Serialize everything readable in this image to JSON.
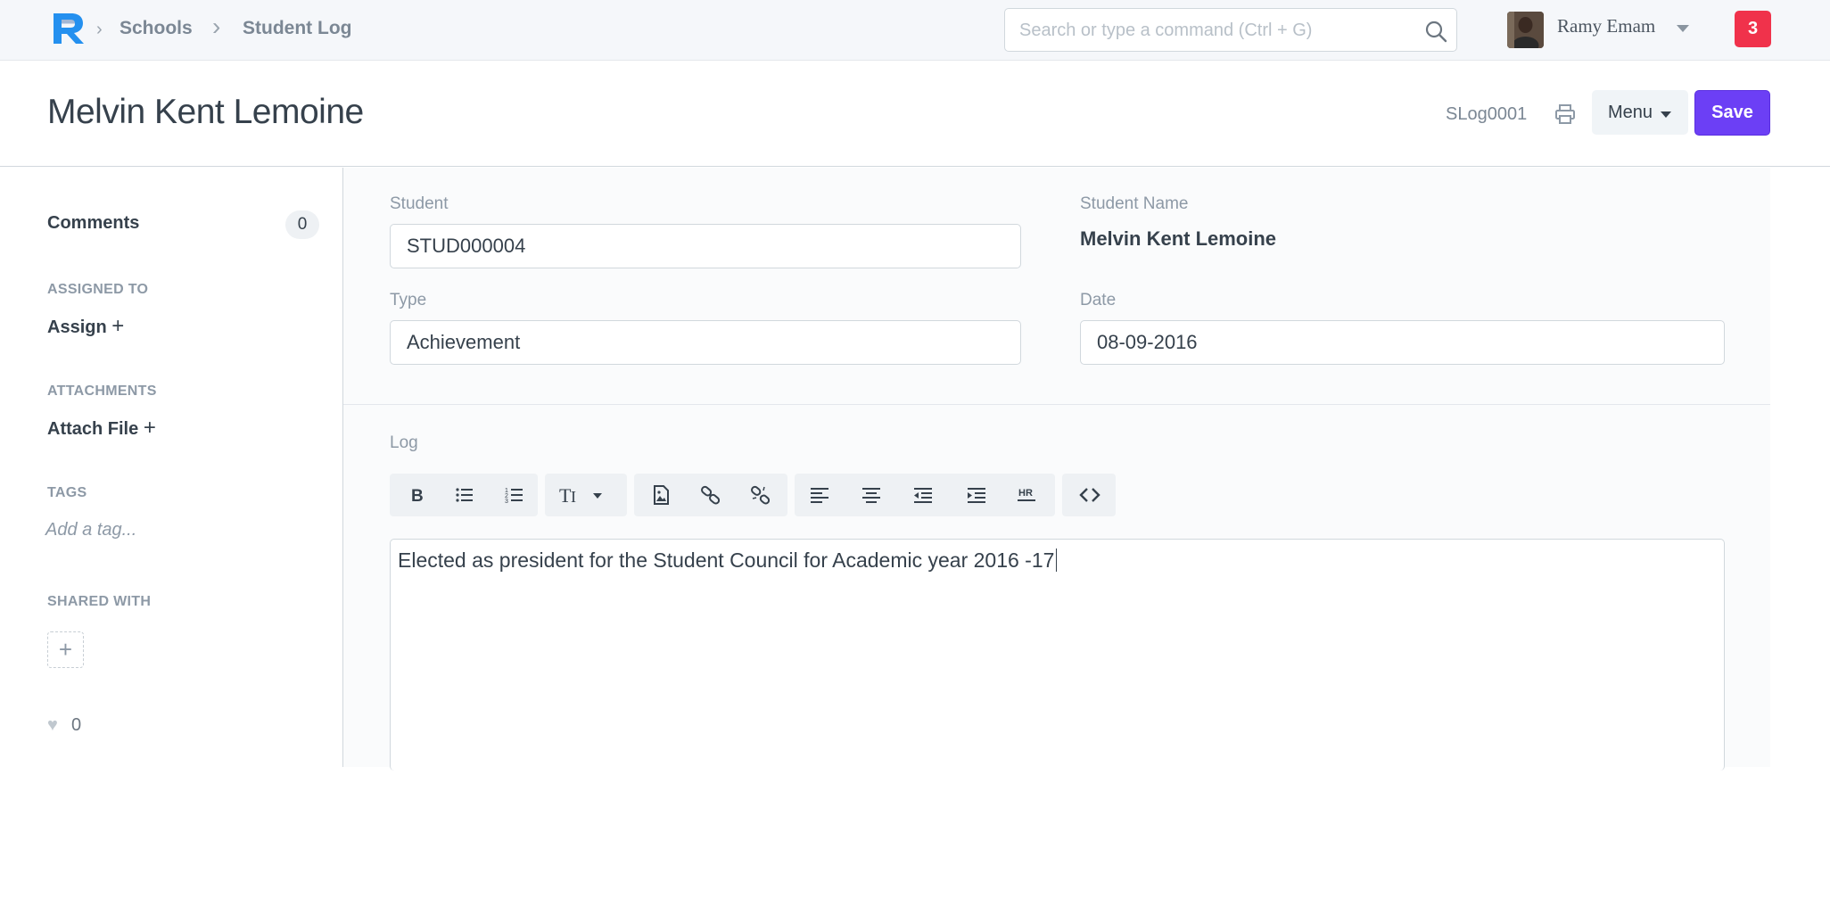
{
  "navbar": {
    "breadcrumbs": [
      "Schools",
      "Student Log"
    ],
    "search_placeholder": "Search or type a command (Ctrl + G)",
    "user_name": "Ramy Emam",
    "notification_count": "3"
  },
  "header": {
    "title": "Melvin Kent Lemoine",
    "doc_name": "SLog0001",
    "menu_label": "Menu",
    "save_label": "Save"
  },
  "sidebar": {
    "comments_label": "Comments",
    "comments_count": "0",
    "assigned_to_label": "ASSIGNED TO",
    "assign_action": "Assign",
    "attachments_label": "ATTACHMENTS",
    "attach_action": "Attach File",
    "tags_label": "TAGS",
    "tag_placeholder": "Add a tag...",
    "shared_with_label": "SHARED WITH",
    "likes_count": "0"
  },
  "form": {
    "student_label": "Student",
    "student_value": "STUD000004",
    "student_name_label": "Student Name",
    "student_name_value": "Melvin Kent Lemoine",
    "type_label": "Type",
    "type_value": "Achievement",
    "date_label": "Date",
    "date_value": "08-09-2016",
    "log_label": "Log",
    "log_text": "Elected as president for the Student Council for Academic year 2016 -17"
  },
  "toolbar_icons": [
    "bold-icon",
    "bullet-list-icon",
    "numbered-list-icon",
    "text-size-icon",
    "image-icon",
    "link-icon",
    "unlink-icon",
    "align-left-icon",
    "align-center-icon",
    "outdent-icon",
    "indent-icon",
    "horizontal-rule-icon",
    "code-view-icon"
  ],
  "colors": {
    "primary": "#6c3ff5",
    "notification": "#f0324b",
    "logo": "#2490ef"
  }
}
